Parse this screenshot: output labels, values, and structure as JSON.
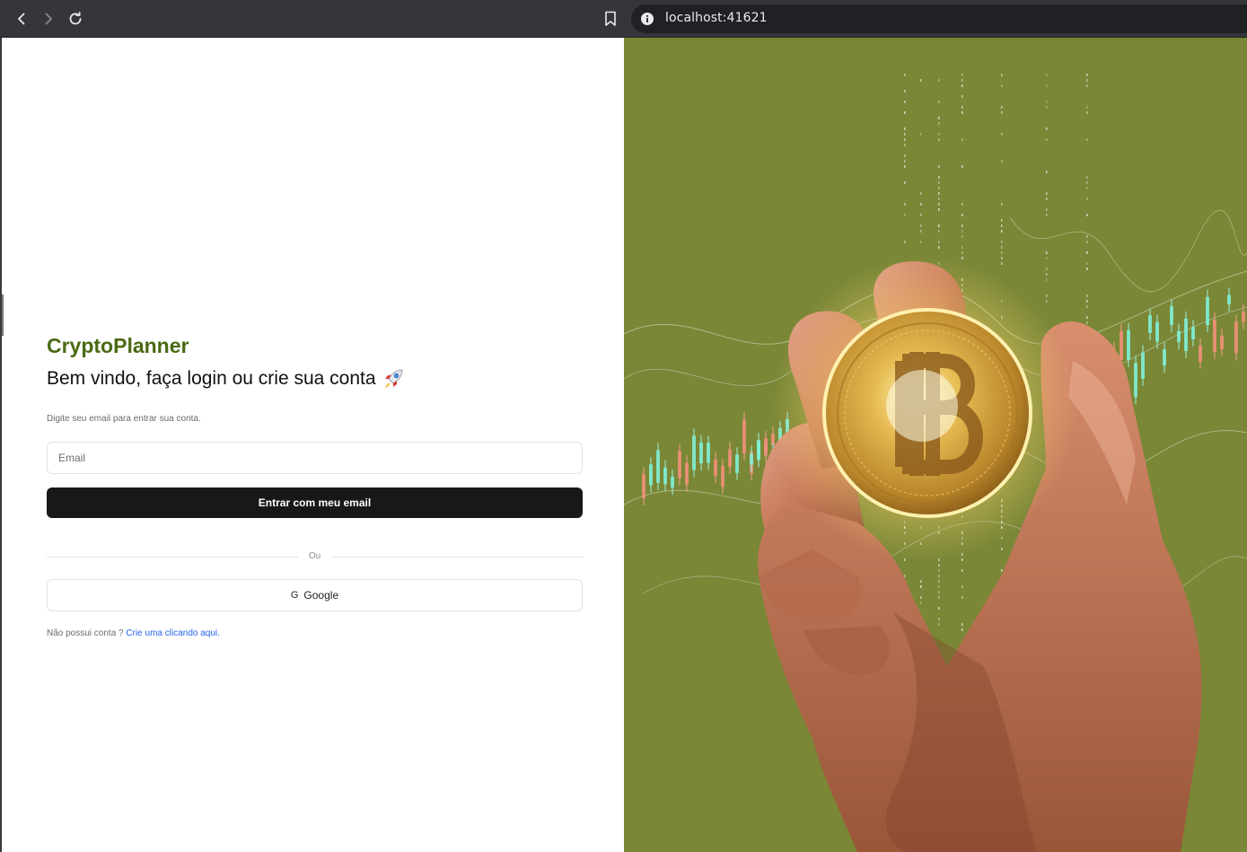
{
  "browser": {
    "url": "localhost:41621",
    "icons": [
      "back-icon",
      "forward-icon",
      "reload-icon",
      "bookmark-icon",
      "info-icon"
    ]
  },
  "login": {
    "brand": "CryptoPlanner",
    "welcome": "Bem vindo, faça login ou crie sua conta",
    "welcome_icon": "rocket-icon",
    "subtitle": "Digite seu email para entrar sua conta.",
    "email_placeholder": "Email",
    "email_value": "",
    "submit_label": "Entrar com meu email",
    "divider_label": "Ou",
    "google_icon_glyph": "G",
    "google_label": "Google",
    "signup_text": "Não possui conta ?",
    "signup_link": "Crie uma clicando aqui."
  },
  "colors": {
    "brand": "#4a6a12",
    "primary_button": "#18181b",
    "link": "#2563eb",
    "hero_background": "#7a8736",
    "coin_gold": "#e0b64a"
  },
  "hero": {
    "image_subject": "hand-holding-bitcoin-coin-with-candlestick-charts",
    "coin_symbol": "bitcoin-icon"
  }
}
